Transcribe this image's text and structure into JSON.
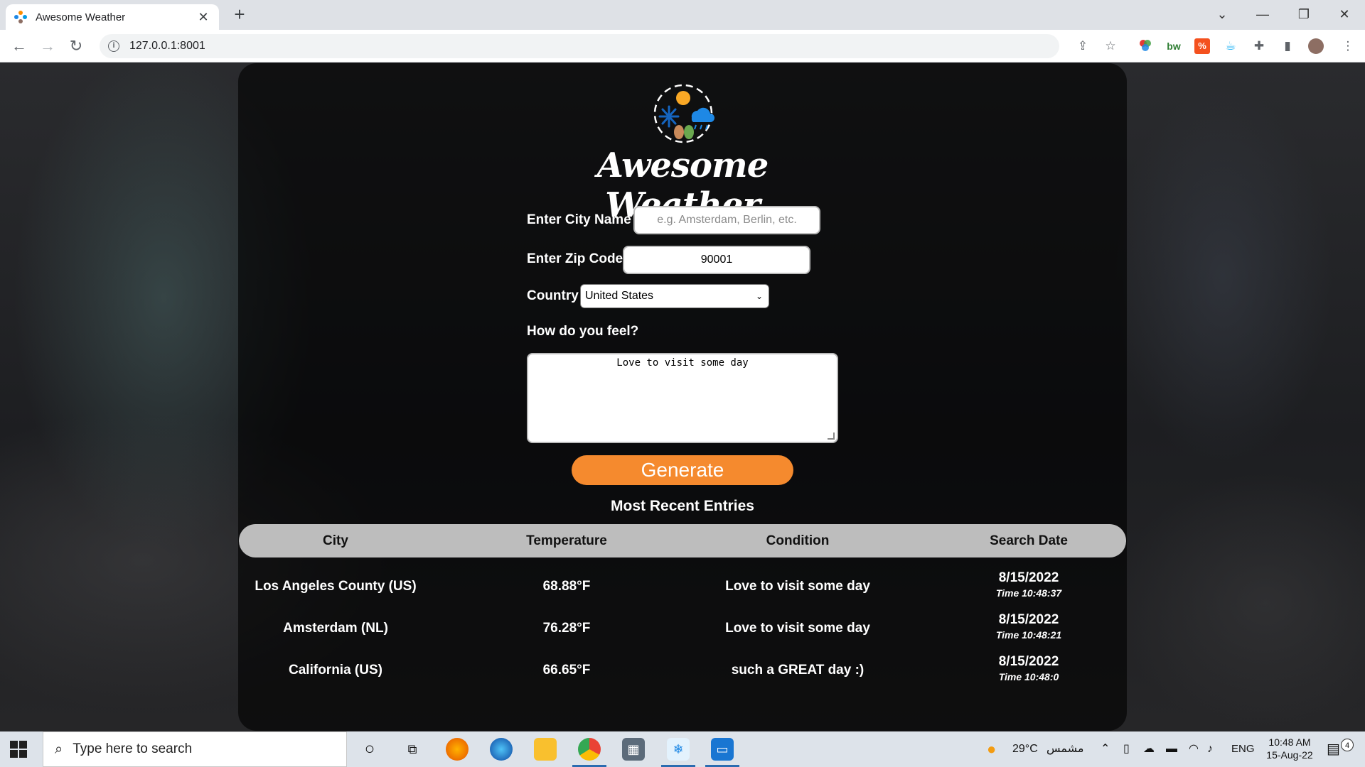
{
  "browser": {
    "tab_title": "Awesome Weather",
    "tab_close": "✕",
    "new_tab": "+",
    "url": "127.0.0.1:8001"
  },
  "app": {
    "title": "Awesome Weather",
    "city_label": "Enter City Name",
    "city_placeholder": "e.g. Amsterdam, Berlin, etc.",
    "city_value": "",
    "zip_label": "Enter Zip Code",
    "zip_value": "90001",
    "country_label": "Country",
    "country_value": "United States",
    "feel_label": "How do you feel?",
    "feel_value": "Love to visit some day",
    "generate_label": "Generate",
    "recent_title": "Most Recent Entries",
    "colors": {
      "accent": "#f58a2e",
      "header_bg": "#bdbdbd"
    }
  },
  "table": {
    "headers": [
      "City",
      "Temperature",
      "Condition",
      "Search Date"
    ],
    "rows": [
      {
        "city": "Los Angeles County (US)",
        "temp": "68.88°F",
        "condition": "Love to visit some day",
        "date": "8/15/2022",
        "time": "Time 10:48:37"
      },
      {
        "city": "Amsterdam (NL)",
        "temp": "76.28°F",
        "condition": "Love to visit some day",
        "date": "8/15/2022",
        "time": "Time 10:48:21"
      },
      {
        "city": "California (US)",
        "temp": "66.65°F",
        "condition": "such a GREAT day :)",
        "date": "8/15/2022",
        "time": "Time 10:48:0"
      }
    ]
  },
  "taskbar": {
    "search_placeholder": "Type here to search",
    "weather": "29°C",
    "weather_text": "مشمس",
    "lang": "ENG",
    "time": "10:48 AM",
    "date": "15-Aug-22",
    "notification_count": "4"
  }
}
